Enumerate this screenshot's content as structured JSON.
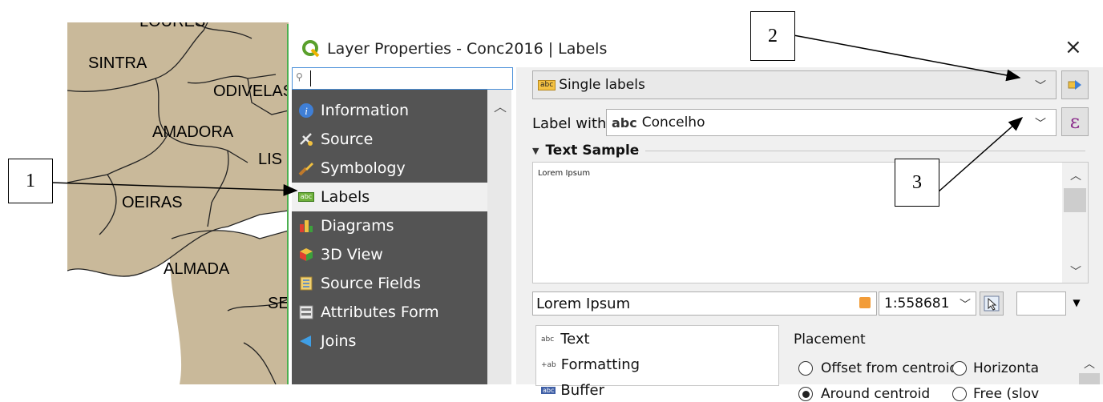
{
  "map": {
    "labels": [
      "SINTRA",
      "ODIVELAS",
      "AMADORA",
      "LIS",
      "OEIRAS",
      "ALMADA",
      "SE"
    ],
    "top_label": "LOURES"
  },
  "dialog": {
    "title": "Layer Properties - Conc2016 | Labels",
    "close": "×",
    "search_placeholder": "",
    "sidebar": {
      "items": [
        {
          "label": "Information",
          "icon": "info-icon"
        },
        {
          "label": "Source",
          "icon": "source-icon"
        },
        {
          "label": "Symbology",
          "icon": "symbology-icon"
        },
        {
          "label": "Labels",
          "icon": "labels-icon",
          "active": true
        },
        {
          "label": "Diagrams",
          "icon": "diagrams-icon"
        },
        {
          "label": "3D View",
          "icon": "3d-view-icon"
        },
        {
          "label": "Source Fields",
          "icon": "source-fields-icon"
        },
        {
          "label": "Attributes Form",
          "icon": "attributes-form-icon"
        },
        {
          "label": "Joins",
          "icon": "joins-icon"
        }
      ]
    },
    "mode_combo": {
      "tag": "abc",
      "value": "Single labels"
    },
    "label_with": {
      "label": "Label with",
      "prefix": "abc",
      "value": "Concelho"
    },
    "expression_button": "ε",
    "text_sample": {
      "header": "Text Sample",
      "preview": "Lorem Ipsum"
    },
    "sample_input": "Lorem Ipsum",
    "scale": "1:558681",
    "tabs": [
      {
        "label": "Text",
        "icon": "text-tab-icon",
        "tag": "abc"
      },
      {
        "label": "Formatting",
        "icon": "formatting-tab-icon",
        "tag": "+ab"
      },
      {
        "label": "Buffer",
        "icon": "buffer-tab-icon",
        "tag": "abc"
      }
    ],
    "placement": {
      "header": "Placement",
      "options": [
        {
          "label": "Offset from centroid",
          "checked": false
        },
        {
          "label": "Horizonta",
          "checked": false
        },
        {
          "label": "Around centroid",
          "checked": true
        },
        {
          "label": "Free (slov",
          "checked": false
        }
      ]
    }
  },
  "callouts": [
    "1",
    "2",
    "3"
  ]
}
